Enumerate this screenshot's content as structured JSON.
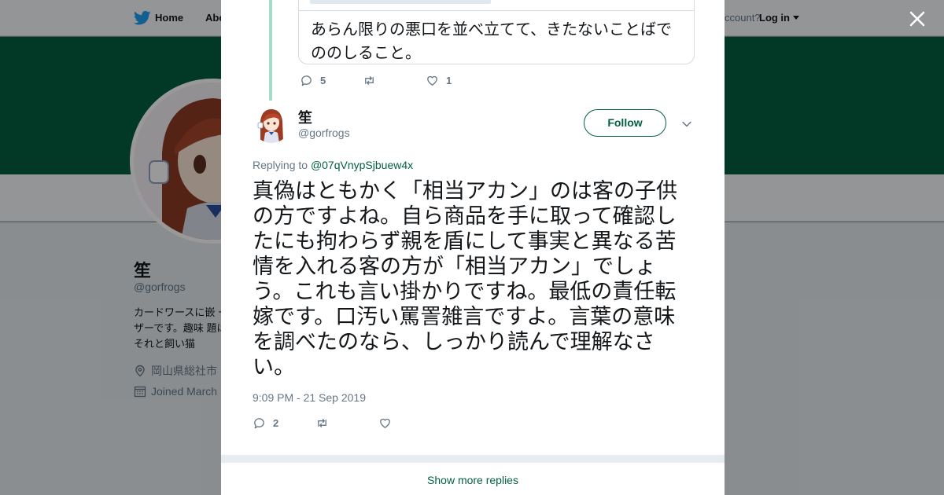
{
  "colors": {
    "brand": "#025f40",
    "muted": "#657786",
    "text": "#14171a"
  },
  "background_page": {
    "nav": {
      "home_label": "Home",
      "about_label": "Abo",
      "account_prompt": "ccount?",
      "login_label": "Log in",
      "bird_icon": "twitter-bird-icon"
    },
    "profile": {
      "name": "笙",
      "handle": "@gorfrogs",
      "bio": "カードワースに嵌 ーザーです。趣味 題はそれと飼い猫",
      "location": "岡山県総社市",
      "joined": "Joined March"
    }
  },
  "close_icon": "close-icon",
  "quoted": {
    "text": "あらん限りの悪口を並べ立てて、きたないことばでののしること。"
  },
  "parent_actions": {
    "reply_count": "5",
    "retweet_count": "",
    "like_count": "1"
  },
  "tweet": {
    "name": "笙",
    "handle": "@gorfrogs",
    "follow_label": "Follow",
    "replying_prefix": "Replying to ",
    "replying_to": "@07qVnypSjbuew4x",
    "text": "真偽はともかく「相当アカン」のは客の子供の方ですよね。自ら商品を手に取って確認したにも拘わらず親を盾にして事実と異なる苦情を入れる客の方が「相当アカン」でしょう。これも言い掛かりですね。最低の責任転嫁です。口汚い罵詈雑言ですよ。言葉の意味を調べたのなら、しっかり読んで理解なさい。",
    "timestamp": "9:09 PM - 21 Sep 2019",
    "actions": {
      "reply_count": "2",
      "retweet_count": "",
      "like_count": ""
    }
  },
  "show_more_label": "Show more replies"
}
